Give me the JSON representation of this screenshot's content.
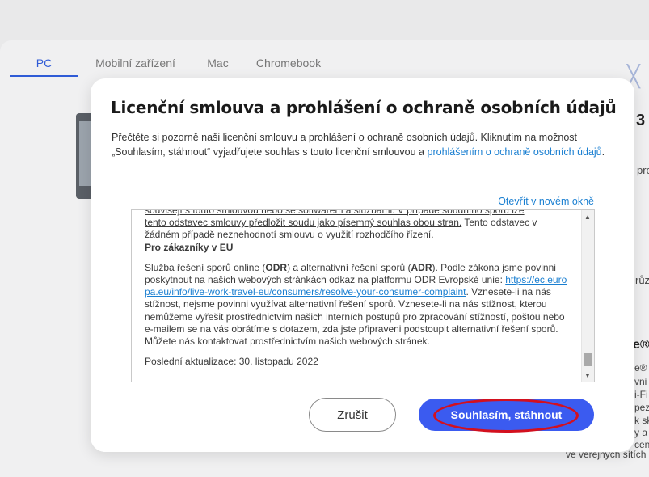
{
  "background": {
    "tabs": [
      "PC",
      "Mobilní zařízení",
      "Mac",
      "Chromebook"
    ],
    "right_fragments": [
      "3",
      "pro",
      "růz",
      "e®",
      "e® s",
      "vni",
      "i-Fi",
      "pez",
      "k sk",
      "y a",
      "a vá",
      "ceny",
      "ve veřejných sítích"
    ]
  },
  "modal": {
    "title": "Licenční smlouva a prohlášení o ochraně osobních údajů",
    "intro_text": "Přečtěte si pozorně naši licenční smlouvu a prohlášení o ochraně osobních údajů. Kliknutím na možnost „Souhlasím, stáhnout“ vyjadřujete souhlas s touto licenční smlouvou a ",
    "intro_link": "prohlášením o ochraně osobních údajů",
    "intro_end": ".",
    "open_new_window": "Otevřít v novém okně",
    "agreement": {
      "line_top": "souvisejí s touto smlouvou nebo se softwarem a službami.  V případě soudního sporu lze",
      "para1_underlined": "tento odstavec smlouvy předložit soudu jako písemný souhlas obou stran.",
      "para1_rest": " Tento odstavec v žádném případě neznehodnotí smlouvu o využití rozhodčího řízení.",
      "heading": "Pro zákazníky v EU",
      "p2_a": "Služba řešení sporů online (",
      "p2_odr": "ODR",
      "p2_b": ") a alternativní řešení sporů (",
      "p2_adr": "ADR",
      "p2_c": "). Podle zákona jsme povinni poskytnout na našich webových stránkách odkaz na platformu ODR Evropské unie: ",
      "p2_link": "https://ec.europa.eu/info/live-work-travel-eu/consumers/resolve-your-consumer-complaint",
      "p2_d": ". Vznesete-li na nás stížnost, nejsme povinni využívat alternativní řešení sporů. Vznesete-li na nás stížnost, kterou nemůžeme vyřešit prostřednictvím našich interních postupů pro zpracování stížností, poštou nebo e-mailem se na vás obrátíme s dotazem, zda jste připraveni podstoupit alternativní řešení sporů. Můžete nás kontaktovat prostřednictvím našich webových stránek.",
      "updated": "Poslední aktualizace: 30. listopadu  2022"
    },
    "cancel_label": "Zrušit",
    "agree_label": "Souhlasím, stáhnout"
  },
  "icons": {
    "close": "close-icon",
    "scroll_up": "scroll-up-arrow-icon",
    "scroll_down": "scroll-down-arrow-icon"
  },
  "colors": {
    "accent": "#3b5bf0",
    "link": "#1a7fd1",
    "highlight": "#d3101e"
  }
}
